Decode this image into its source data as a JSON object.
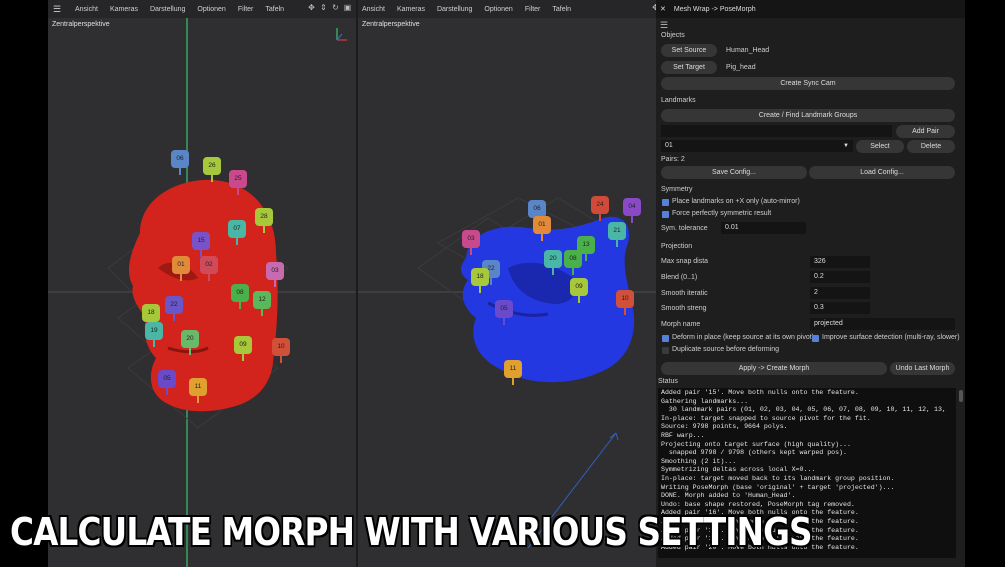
{
  "viewport_left": {
    "menu": [
      "Ansicht",
      "Kameras",
      "Darstellung",
      "Optionen",
      "Filter",
      "Tafeln"
    ],
    "label": "Zentralperspektive",
    "pins": [
      {
        "t": "06",
        "c": "#5a86c8"
      },
      {
        "t": "26",
        "c": "#a6c83a"
      },
      {
        "t": "25",
        "c": "#c84a8c"
      },
      {
        "t": "28",
        "c": "#a6c83a"
      },
      {
        "t": "07",
        "c": "#4ab6a6"
      },
      {
        "t": "15",
        "c": "#7a52c8"
      },
      {
        "t": "01",
        "c": "#e08a3a"
      },
      {
        "t": "02",
        "c": "#d04a5a"
      },
      {
        "t": "03",
        "c": "#c86ab0"
      },
      {
        "t": "08",
        "c": "#4ab04a"
      },
      {
        "t": "12",
        "c": "#5ab85a"
      },
      {
        "t": "22",
        "c": "#6a56c8"
      },
      {
        "t": "18",
        "c": "#a6c83a"
      },
      {
        "t": "19",
        "c": "#4ab6a6"
      },
      {
        "t": "20",
        "c": "#6ab86a"
      },
      {
        "t": "09",
        "c": "#a6c83a"
      },
      {
        "t": "10",
        "c": "#d0503a"
      },
      {
        "t": "05",
        "c": "#6a4ac8"
      },
      {
        "t": "11",
        "c": "#e0a030"
      }
    ]
  },
  "viewport_right": {
    "menu": [
      "Ansicht",
      "Kameras",
      "Darstellung",
      "Optionen",
      "Filter",
      "Tafeln"
    ],
    "label": "Zentralperspektive",
    "pins": [
      {
        "t": "03",
        "c": "#c84a8c"
      },
      {
        "t": "06",
        "c": "#5a86c8"
      },
      {
        "t": "01",
        "c": "#e08a3a"
      },
      {
        "t": "24",
        "c": "#d04a3a"
      },
      {
        "t": "04",
        "c": "#8a4ac8"
      },
      {
        "t": "21",
        "c": "#4ab6a6"
      },
      {
        "t": "13",
        "c": "#4ab04a"
      },
      {
        "t": "22",
        "c": "#5a86c8"
      },
      {
        "t": "18",
        "c": "#a6c83a"
      },
      {
        "t": "20",
        "c": "#4ab6a6"
      },
      {
        "t": "08",
        "c": "#4ab04a"
      },
      {
        "t": "09",
        "c": "#a6c83a"
      },
      {
        "t": "05",
        "c": "#6a4ac8"
      },
      {
        "t": "10",
        "c": "#d0503a"
      },
      {
        "t": "11",
        "c": "#e0a030"
      }
    ]
  },
  "panel": {
    "title": "Mesh Wrap -> PoseMorph",
    "objects_label": "Objects",
    "set_source": "Set Source",
    "source_value": "Human_Head",
    "set_target": "Set Target",
    "target_value": "Pig_head",
    "create_sync_cam": "Create Sync Cam",
    "landmarks_label": "Landmarks",
    "create_find_groups": "Create / Find Landmark Groups",
    "pair_input": "",
    "add_pair": "Add Pair",
    "pair_select": "01",
    "select": "Select",
    "delete": "Delete",
    "pairs_count": "Pairs: 2",
    "save_config": "Save Config...",
    "load_config": "Load Config...",
    "symmetry_label": "Symmetry",
    "sym_opt1": "Place landmarks on +X only (auto-mirror)",
    "sym_opt2": "Force perfectly symmetric result",
    "sym_tol_label": "Sym. tolerance",
    "sym_tol_value": "0.01",
    "projection_label": "Projection",
    "max_snap_label": "Max snap dista",
    "max_snap_value": "326",
    "blend_label": "Blend (0..1)",
    "blend_value": "0.2",
    "smooth_iter_label": "Smooth iteratic",
    "smooth_iter_value": "2",
    "smooth_str_label": "Smooth streng",
    "smooth_str_value": "0.3",
    "morph_name_label": "Morph name",
    "morph_name_value": "projected",
    "deform_in_place": "Deform in place (keep source at its own pivot)",
    "improve_detection": "Improve surface detection (multi-ray, slower)",
    "duplicate_source": "Duplicate source before deforming",
    "apply_create_morph": "Apply -> Create Morph",
    "undo_last_morph": "Undo Last Morph",
    "status_label": "Status",
    "status_lines": [
      "Added pair '15'. Move both nulls onto the feature.",
      "Gathering landmarks...",
      "  30 landmark pairs (01, 02, 03, 04, 05, 06, 07, 08, 09, 10, 11, 12, 13,",
      "In-place: target snapped to source pivot for the fit.",
      "Source: 9798 points, 9664 polys.",
      "RBF warp...",
      "Projecting onto target surface (high quality)...",
      "  snapped 9798 / 9798 (others kept warped pos).",
      "Smoothing (2 it)...",
      "Symmetrizing deltas across local X=0...",
      "In-place: target moved back to its landmark group position.",
      "Writing PoseMorph (base 'original' + target 'projected')...",
      "DONE. Morph added to 'Human_Head'.",
      "Undo: base shape restored, PoseMorph tag removed.",
      "Added pair '16'. Move both nulls onto the feature.",
      "Added pair '17'. Move both nulls onto the feature.",
      "Added pair '18'. Move both nulls onto the feature.",
      "Added pair '19'. Move both nulls onto the feature.",
      "Added pair '20'. Move both nulls onto the feature."
    ]
  },
  "caption": "CALCULATE MORPH WITH VARIOUS SETTINGS"
}
